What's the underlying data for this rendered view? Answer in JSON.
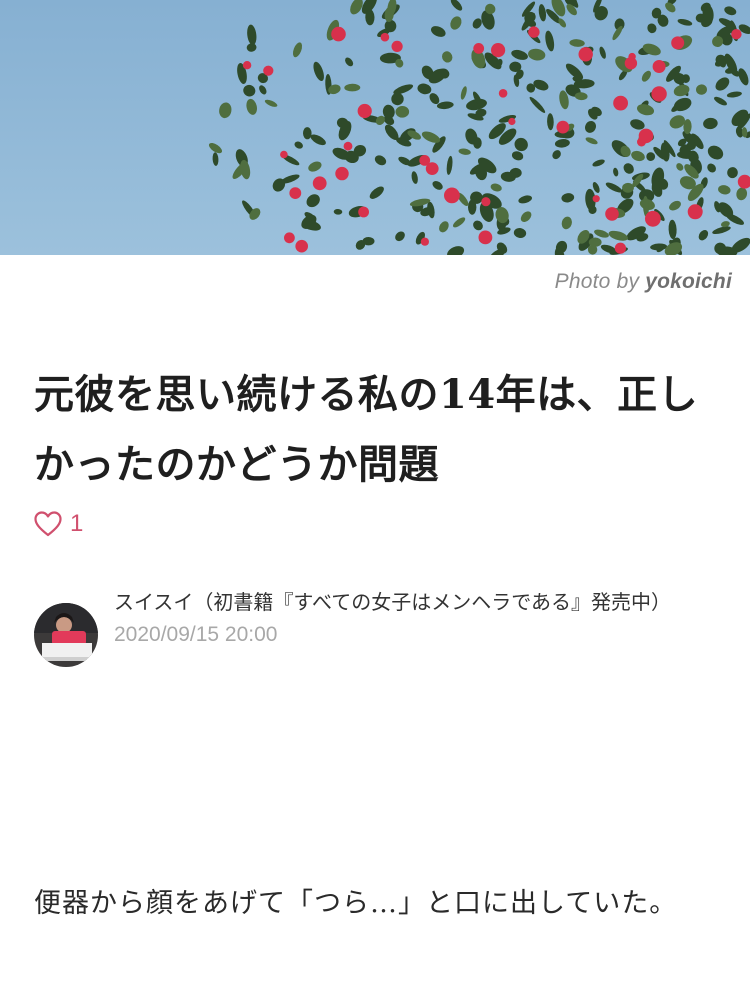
{
  "hero": {
    "photo_credit_prefix": "Photo by",
    "photo_credit_name": "yokoichi"
  },
  "article": {
    "title": "元彼を思い続ける私の14年は、正しかったのかどうか問題",
    "likes": "1",
    "author_name": "スイスイ（初書籍『すべての女子はメンヘラである』発売中）",
    "date": "2020/09/15 20:00",
    "body_first_line": "便器から顔をあげて「つら…」と口に出していた。"
  },
  "colors": {
    "accent": "#d0506e",
    "sky": "#8fb6d4",
    "foliage": "#2f4a2a",
    "blossom": "#d8314c"
  }
}
